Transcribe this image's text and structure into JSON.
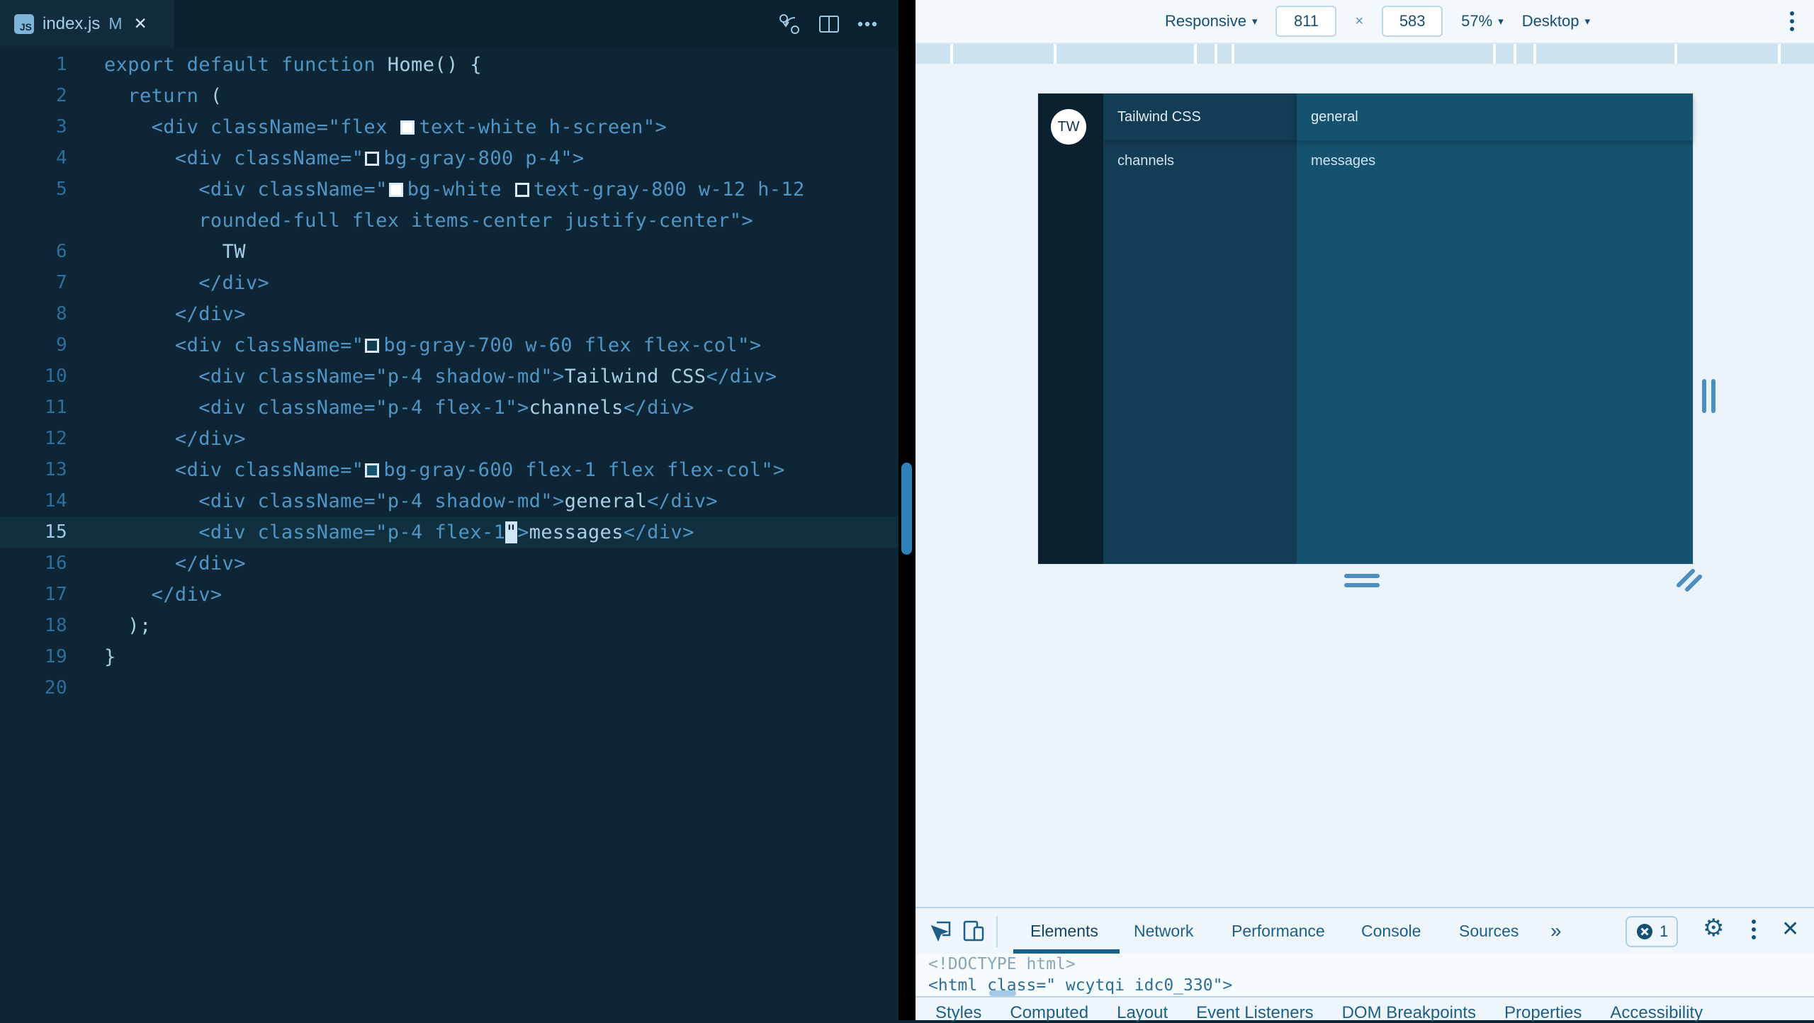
{
  "colors": {
    "editor_bg": "#0d2534",
    "tabstrip_bg": "#0a2130",
    "tab_bg": "#122b3d",
    "code_blue": "#4f96c6",
    "code_plain": "#a9cfe6",
    "scrollbar": "#2f81ba",
    "devtools_bg": "#ebf3fa",
    "dt_text": "#1d5e86",
    "ruler": "#cde2f0",
    "app_gray800": "#0a2230",
    "app_gray700": "#133c55",
    "app_gray600": "#155270",
    "active_underline": "#1b6089"
  },
  "editor": {
    "tab": {
      "filename": "index.js",
      "modified": "M",
      "close": "✕",
      "badge": "JS"
    },
    "actions": {
      "changes": "open-changes",
      "split": "split-editor",
      "more": "more-actions"
    },
    "lines": [
      {
        "n": "1",
        "segs": [
          {
            "t": "export default function ",
            "c": "k"
          },
          {
            "t": "Home() {",
            "c": "p"
          }
        ]
      },
      {
        "n": "2",
        "segs": [
          {
            "t": "  return ",
            "c": "k"
          },
          {
            "t": "(",
            "c": "p"
          }
        ]
      },
      {
        "n": "3",
        "segs": [
          {
            "t": "    <div className=\"flex ",
            "c": "k"
          },
          {
            "sw": "white"
          },
          {
            "t": "text-white h-screen\">",
            "c": "k"
          }
        ]
      },
      {
        "n": "4",
        "segs": [
          {
            "t": "      <div className=\"",
            "c": "k"
          },
          {
            "sw": "g800"
          },
          {
            "t": "bg-gray-800 p-4\">",
            "c": "k"
          }
        ]
      },
      {
        "n": "5",
        "segs": [
          {
            "t": "        <div className=\"",
            "c": "k"
          },
          {
            "sw": "white"
          },
          {
            "t": "bg-white ",
            "c": "k"
          },
          {
            "sw": "g800"
          },
          {
            "t": "text-gray-800 w-12 h-12",
            "c": "k"
          }
        ]
      },
      {
        "n": "",
        "segs": [
          {
            "t": "        rounded-full flex items-center justify-center\">",
            "c": "k"
          }
        ]
      },
      {
        "n": "6",
        "segs": [
          {
            "t": "          ",
            "c": "k"
          },
          {
            "t": "TW",
            "c": "p"
          }
        ]
      },
      {
        "n": "7",
        "segs": [
          {
            "t": "        </div>",
            "c": "k"
          }
        ]
      },
      {
        "n": "8",
        "segs": [
          {
            "t": "      </div>",
            "c": "k"
          }
        ]
      },
      {
        "n": "9",
        "segs": [
          {
            "t": "      <div className=\"",
            "c": "k"
          },
          {
            "sw": "g700"
          },
          {
            "t": "bg-gray-700 w-60 flex flex-col\">",
            "c": "k"
          }
        ]
      },
      {
        "n": "10",
        "segs": [
          {
            "t": "        <div className=\"p-4 shadow-md\">",
            "c": "k"
          },
          {
            "t": "Tailwind CSS",
            "c": "p"
          },
          {
            "t": "</div>",
            "c": "k"
          }
        ]
      },
      {
        "n": "11",
        "segs": [
          {
            "t": "        <div className=\"p-4 flex-1\">",
            "c": "k"
          },
          {
            "t": "channels",
            "c": "p"
          },
          {
            "t": "</div>",
            "c": "k"
          }
        ]
      },
      {
        "n": "12",
        "segs": [
          {
            "t": "      </div>",
            "c": "k"
          }
        ]
      },
      {
        "n": "13",
        "segs": [
          {
            "t": "      <div className=\"",
            "c": "k"
          },
          {
            "sw": "g600"
          },
          {
            "t": "bg-gray-600 flex-1 flex flex-col\">",
            "c": "k"
          }
        ]
      },
      {
        "n": "14",
        "segs": [
          {
            "t": "        <div className=\"p-4 shadow-md\">",
            "c": "k"
          },
          {
            "t": "general",
            "c": "p"
          },
          {
            "t": "</div>",
            "c": "k"
          }
        ]
      },
      {
        "n": "15",
        "current": true,
        "segs": [
          {
            "t": "        <div className=\"p-4 flex-1",
            "c": "k"
          },
          {
            "cur": "\""
          },
          {
            "t": ">",
            "c": "k"
          },
          {
            "t": "messages",
            "c": "p"
          },
          {
            "t": "</div>",
            "c": "k"
          }
        ]
      },
      {
        "n": "16",
        "segs": [
          {
            "t": "      </div>",
            "c": "k"
          }
        ]
      },
      {
        "n": "17",
        "segs": [
          {
            "t": "    </div>",
            "c": "k"
          }
        ]
      },
      {
        "n": "18",
        "segs": [
          {
            "t": "  );",
            "c": "p"
          }
        ]
      },
      {
        "n": "19",
        "segs": [
          {
            "t": "}",
            "c": "p"
          }
        ]
      },
      {
        "n": "20",
        "segs": []
      }
    ]
  },
  "devtools": {
    "toolbar": {
      "device_select": "Responsive",
      "width": "811",
      "times": "×",
      "height": "583",
      "zoom": "57%",
      "display_mode": "Desktop",
      "arrow": "▾"
    },
    "ruler_gaps": [
      49,
      195,
      393,
      422,
      446,
      815,
      844,
      872,
      1071,
      1217
    ],
    "preview": {
      "app": {
        "logo": "TW",
        "workspace_title": "Tailwind CSS",
        "sidebar_item": "channels",
        "channel_header": "general",
        "content_label": "messages"
      }
    },
    "tabs": [
      "Elements",
      "Network",
      "Performance",
      "Console",
      "Sources",
      "»"
    ],
    "active_tab": "Elements",
    "error_count": "1",
    "close": "✕",
    "elements_lines": [
      {
        "text": "<!DOCTYPE html>",
        "c": "grey"
      },
      {
        "text": "<html class=\" wcytqi idc0_330\">",
        "c": "blue"
      }
    ],
    "styles_tabs": [
      "Styles",
      "Computed",
      "Layout",
      "Event Listeners",
      "DOM Breakpoints",
      "Properties",
      "Accessibility"
    ]
  }
}
